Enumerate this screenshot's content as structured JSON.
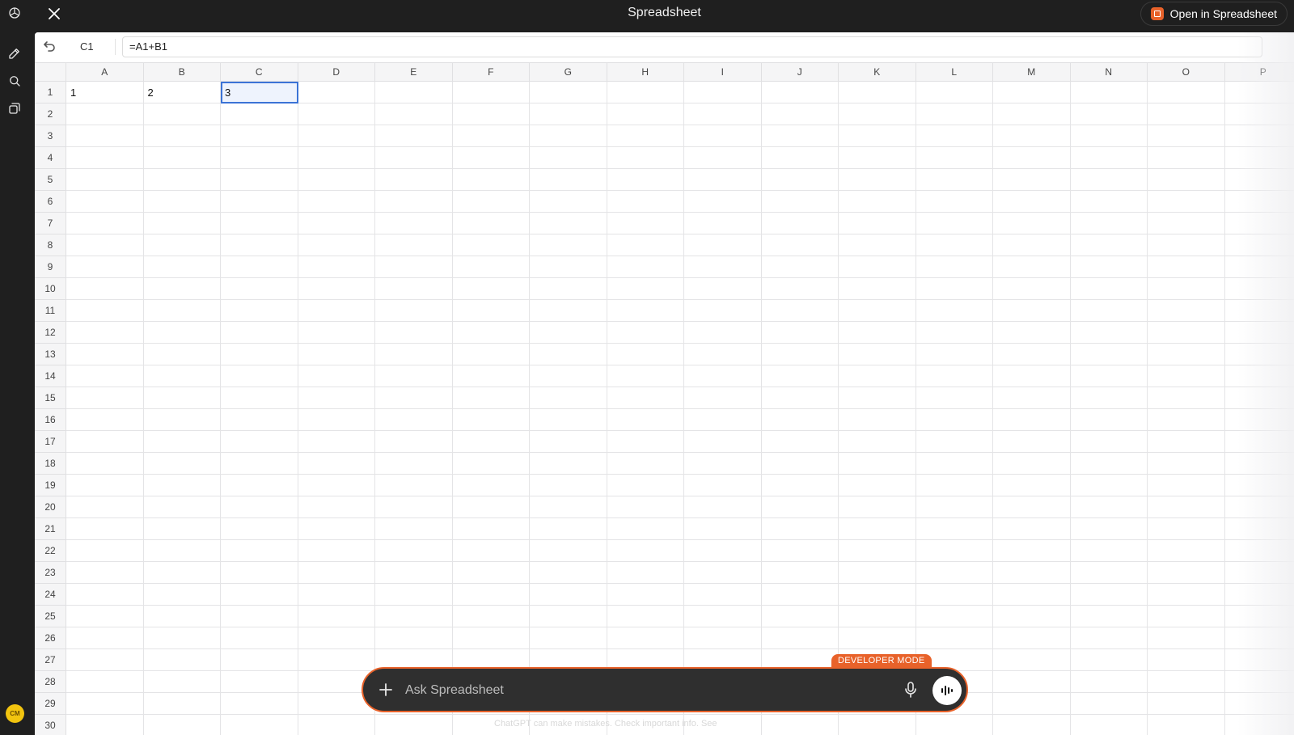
{
  "header": {
    "title": "Spreadsheet",
    "open_button_label": "Open in Spreadsheet"
  },
  "sidebar": {
    "avatar_initials": "CM",
    "icons": [
      "openai-logo-icon",
      "new-chat-icon",
      "search-icon",
      "library-icon"
    ]
  },
  "formula_bar": {
    "cell_ref": "C1",
    "formula": "=A1+B1"
  },
  "sheet": {
    "columns": [
      "A",
      "B",
      "C",
      "D",
      "E",
      "F",
      "G",
      "H",
      "I",
      "J",
      "K",
      "L",
      "M",
      "N",
      "O",
      "P"
    ],
    "rows": [
      "1",
      "2",
      "3",
      "4",
      "5",
      "6",
      "7",
      "8",
      "9",
      "10",
      "11",
      "12",
      "13",
      "14",
      "15",
      "16",
      "17",
      "18",
      "19",
      "20",
      "21",
      "22",
      "23",
      "24",
      "25",
      "26",
      "27",
      "28",
      "29",
      "30"
    ],
    "cells": {
      "A1": "1",
      "B1": "2",
      "C1": "3"
    },
    "selected_cell": "C1"
  },
  "composer": {
    "badge": "DEVELOPER MODE",
    "placeholder": "Ask Spreadsheet",
    "disclaimer": "ChatGPT can make mistakes. Check important info. See"
  },
  "colors": {
    "accent": "#e8622a",
    "selection": "#3b73d6",
    "chrome": "#1f1f1f"
  }
}
